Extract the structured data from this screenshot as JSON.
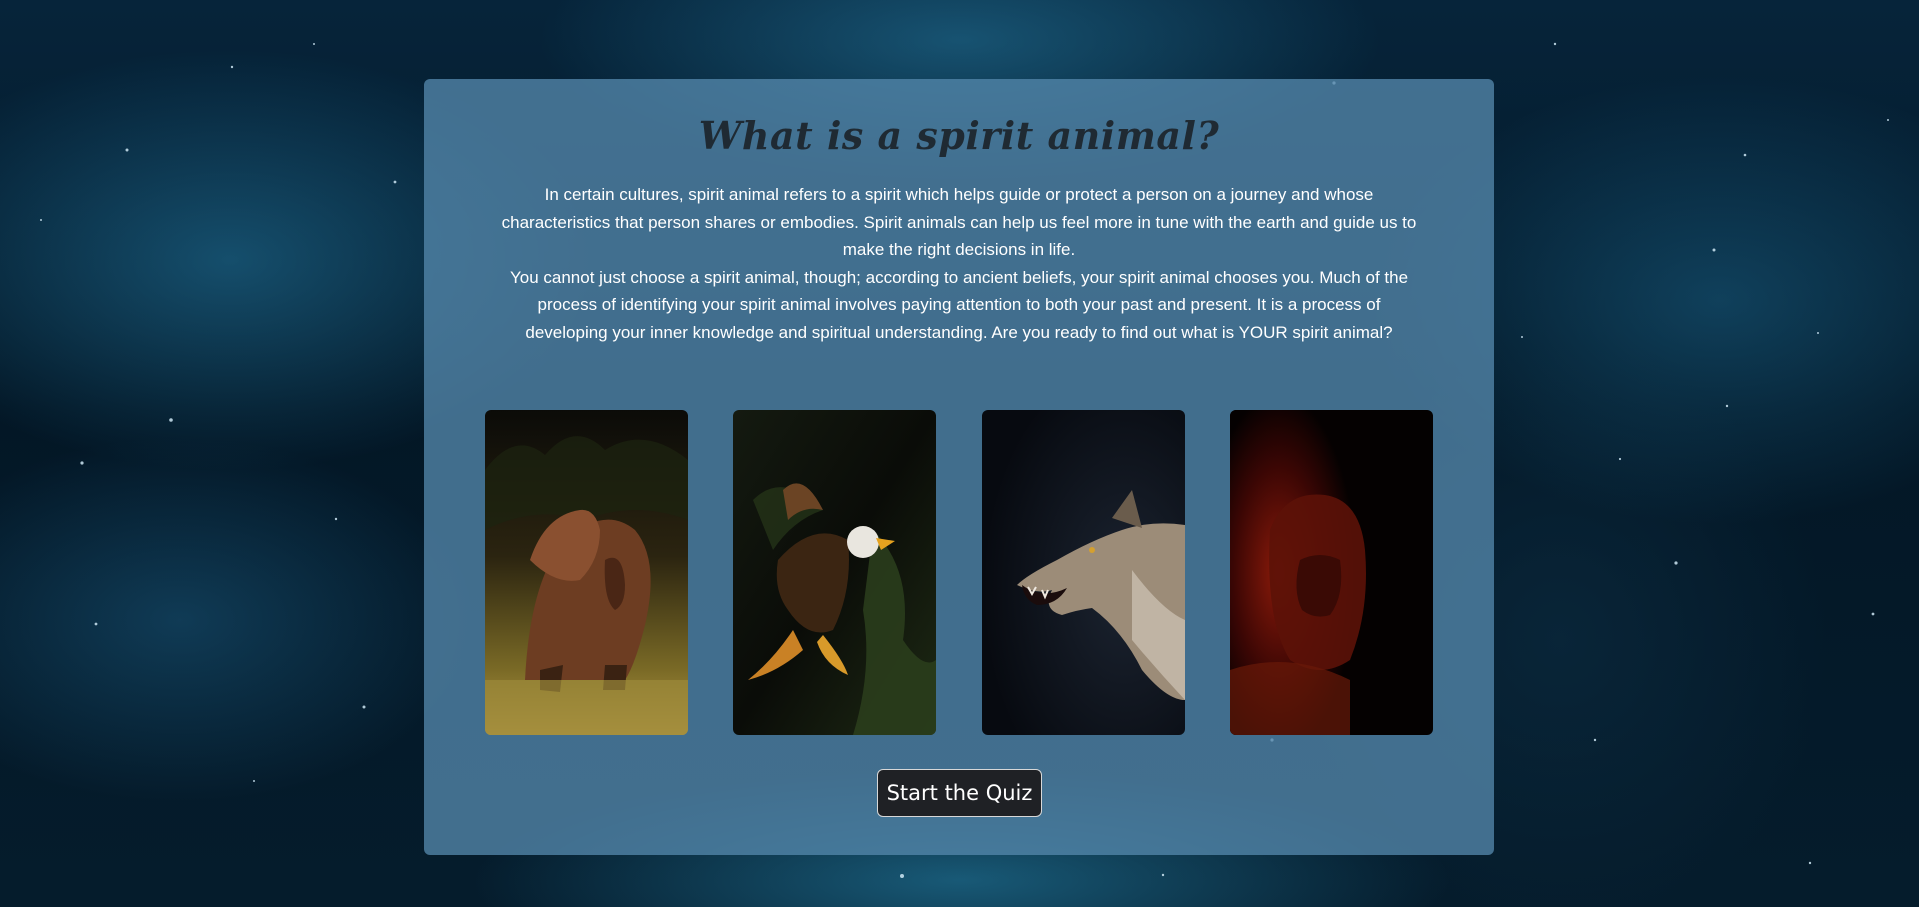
{
  "page": {
    "title": "What is a spirit animal?",
    "paragraph_1": "In certain cultures, spirit animal refers to a spirit which helps guide or protect a person on a journey and whose characteristics that person shares or embodies. Spirit animals can help us feel more in tune with the earth and guide us to make the right decisions in life.",
    "paragraph_2": "You cannot just choose a spirit animal, though; according to ancient beliefs, your spirit animal chooses you. Much of the process of identifying your spirit animal involves paying attention to both your past and present. It is a process of developing your inner knowledge and spiritual understanding. Are you ready to find out what is YOUR spirit animal?",
    "cta_label": "Start the Quiz"
  },
  "gallery": [
    {
      "animal": "bear"
    },
    {
      "animal": "eagle"
    },
    {
      "animal": "wolf"
    },
    {
      "animal": "lion"
    }
  ],
  "colors": {
    "card_background": "#5386aa",
    "title_text": "#1f2a33",
    "body_text": "#ffffff",
    "button_background": "#1f2125",
    "button_text": "#ffffff"
  }
}
